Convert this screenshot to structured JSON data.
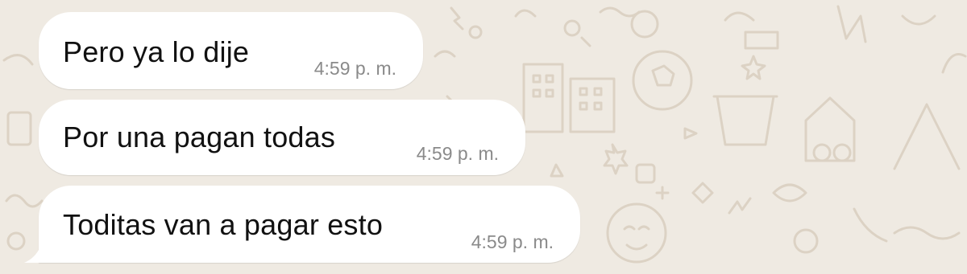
{
  "colors": {
    "wallpaper": "#efeae2",
    "wallpaper_doodles": "#dcd2c4",
    "bubble_incoming": "#ffffff",
    "message_text": "#111111",
    "timestamp_text": "#8a8a8a"
  },
  "chat": {
    "messages": [
      {
        "text": "Pero ya lo dije",
        "time": "4:59 p. m."
      },
      {
        "text": "Por una pagan todas",
        "time": "4:59 p. m."
      },
      {
        "text": "Toditas van a pagar esto",
        "time": "4:59 p. m."
      }
    ]
  }
}
